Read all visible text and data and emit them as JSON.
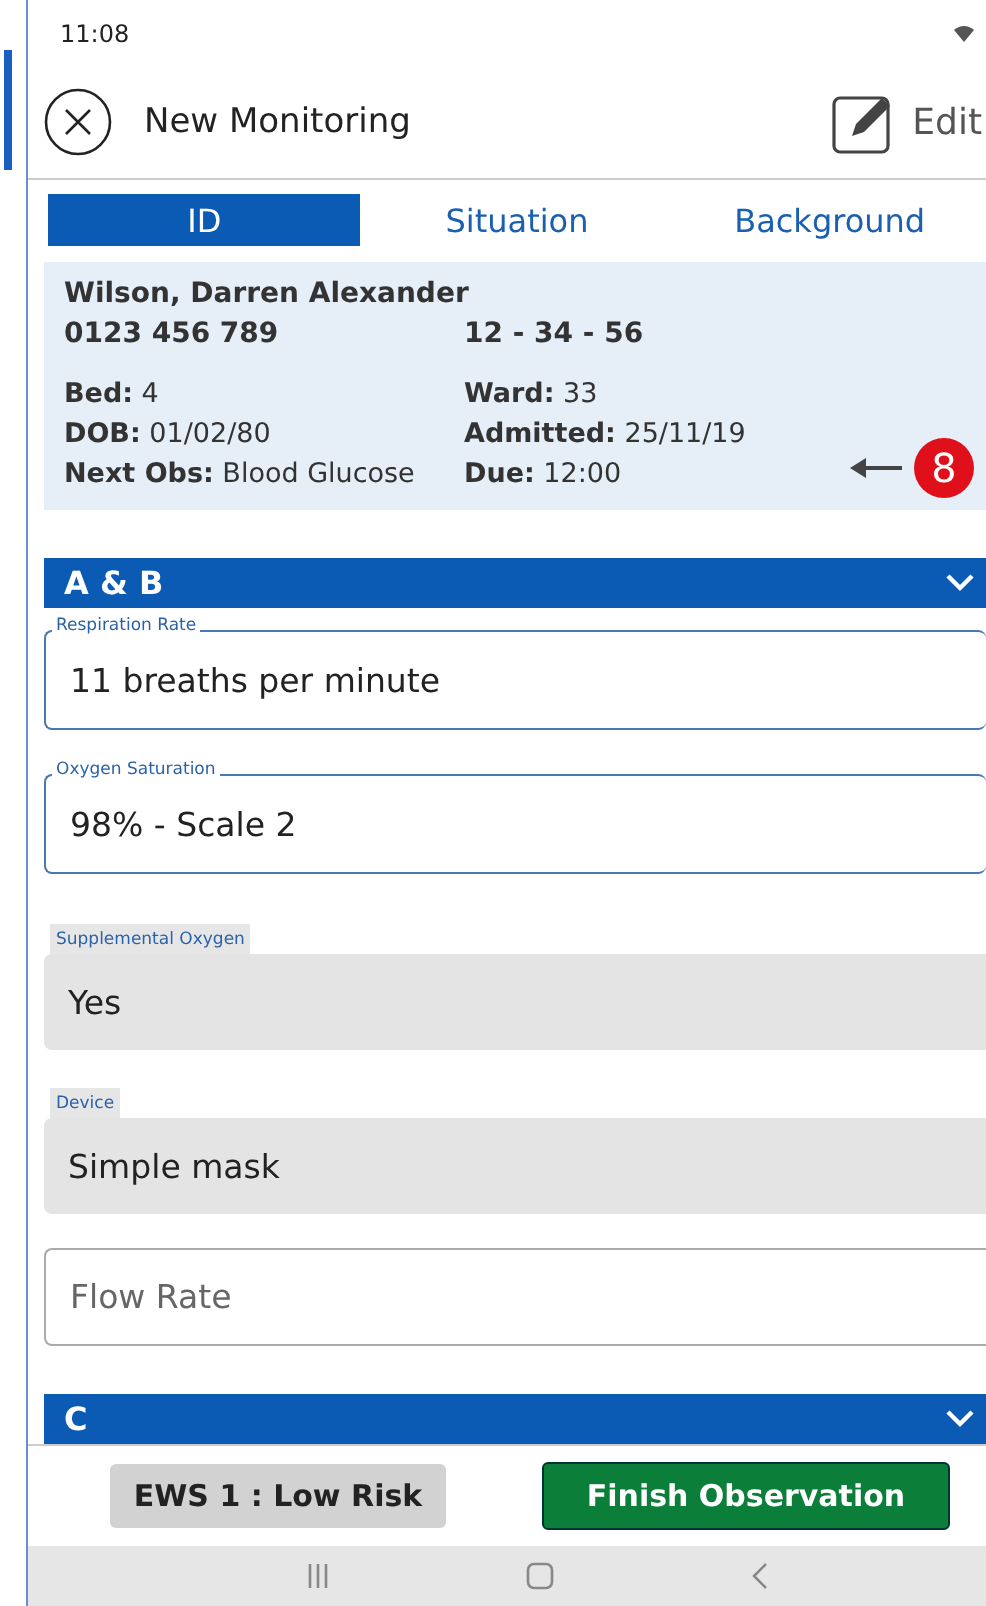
{
  "status_bar": {
    "time": "11:08"
  },
  "header": {
    "title": "New Monitoring",
    "edit_label": "Edit"
  },
  "tabs": [
    {
      "label": "ID",
      "selected": true
    },
    {
      "label": "Situation",
      "selected": false
    },
    {
      "label": "Background",
      "selected": false
    }
  ],
  "patient": {
    "name": "Wilson, Darren Alexander",
    "number": "0123 456 789",
    "code": "12 - 34 - 56",
    "details": [
      {
        "label": "Bed:",
        "value": "4"
      },
      {
        "label": "Ward:",
        "value": "33"
      },
      {
        "label": "DOB:",
        "value": "01/02/80"
      },
      {
        "label": "Admitted:",
        "value": "25/11/19"
      },
      {
        "label": "Next Obs:",
        "value": "Blood Glucose"
      },
      {
        "label": "Due:",
        "value": "12:00"
      }
    ]
  },
  "callout": {
    "number": "8"
  },
  "sections": [
    {
      "title": "A & B",
      "fields": [
        {
          "kind": "outlined",
          "label": "Respiration Rate",
          "value": "11 breaths per minute"
        },
        {
          "kind": "outlined",
          "label": "Oxygen Saturation",
          "value": "98% - Scale 2"
        },
        {
          "kind": "filled",
          "label": "Supplemental Oxygen",
          "value": "Yes"
        },
        {
          "kind": "filled",
          "label": "Device",
          "value": "Simple mask"
        },
        {
          "kind": "empty",
          "placeholder": "Flow Rate"
        }
      ]
    },
    {
      "title": "C"
    }
  ],
  "footer": {
    "score": "EWS 1 : Low Risk",
    "finish": "Finish Observation"
  }
}
